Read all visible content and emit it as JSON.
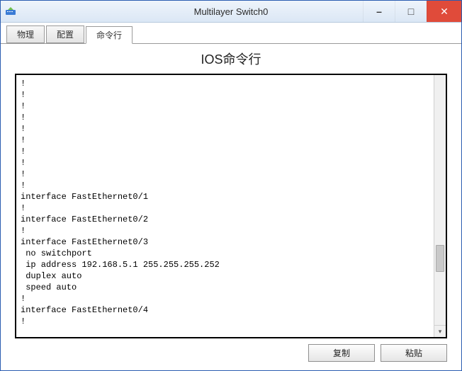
{
  "window": {
    "title": "Multilayer Switch0"
  },
  "tabs": {
    "items": [
      {
        "label": "物理"
      },
      {
        "label": "配置"
      },
      {
        "label": "命令行"
      }
    ],
    "active_index": 2
  },
  "panel": {
    "heading": "IOS命令行"
  },
  "terminal": {
    "text": "!\n!\n!\n!\n!\n!\n!\n!\n!\n!\ninterface FastEthernet0/1\n!\ninterface FastEthernet0/2\n!\ninterface FastEthernet0/3\n no switchport\n ip address 192.168.5.1 255.255.255.252\n duplex auto\n speed auto\n!\ninterface FastEthernet0/4\n!"
  },
  "buttons": {
    "copy": "复制",
    "paste": "粘贴"
  },
  "win_controls": {
    "minimize": "–",
    "maximize": "□",
    "close": "✕"
  }
}
